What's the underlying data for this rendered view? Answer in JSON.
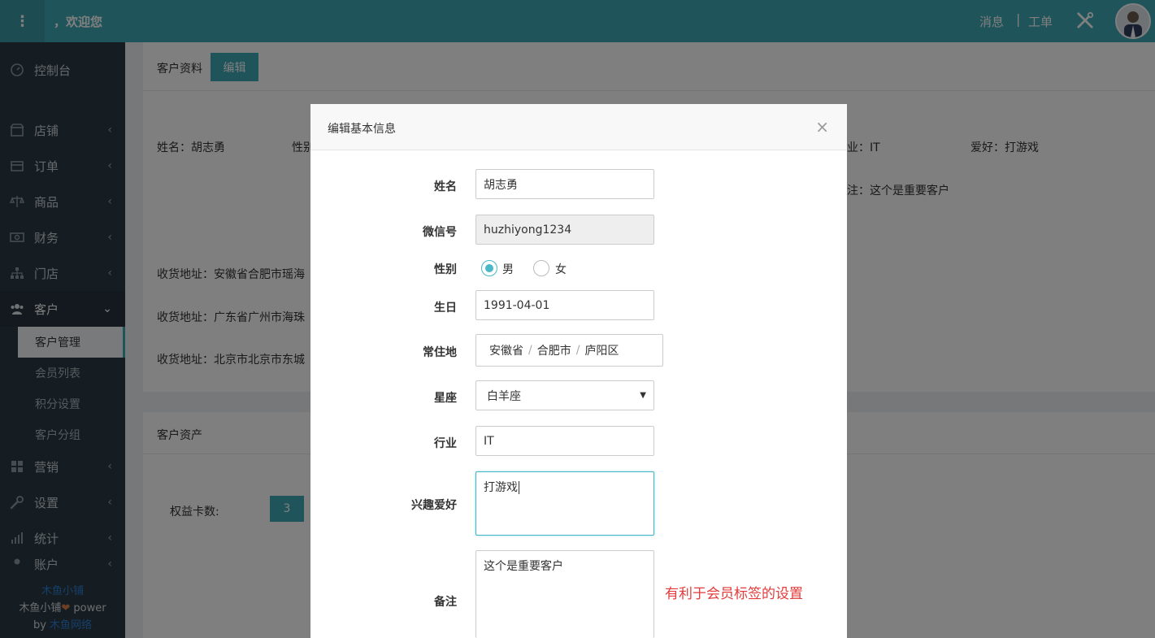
{
  "header": {
    "menu_icon": "vertical-dots-icon",
    "welcome": "，欢迎您",
    "nav_message": "消息",
    "nav_separator": "|",
    "nav_workorder": "工单",
    "tool_icon": "tools-icon"
  },
  "sidebar": {
    "items": [
      {
        "label": "控制台",
        "icon": "dashboard-icon"
      },
      {
        "label": "店铺",
        "icon": "store-icon"
      },
      {
        "label": "订单",
        "icon": "order-icon"
      },
      {
        "label": "商品",
        "icon": "scale-icon"
      },
      {
        "label": "财务",
        "icon": "money-icon"
      },
      {
        "label": "门店",
        "icon": "sitemap-icon"
      },
      {
        "label": "客户",
        "icon": "users-icon"
      },
      {
        "label": "营销",
        "icon": "marketing-icon"
      },
      {
        "label": "设置",
        "icon": "wrench-icon"
      },
      {
        "label": "统计",
        "icon": "chart-icon"
      },
      {
        "label": "账户",
        "icon": "account-icon"
      }
    ],
    "sub_items": [
      "客户管理",
      "会员列表",
      "积分设置",
      "客户分组"
    ],
    "footer": {
      "brand": "木鱼小铺",
      "power_prefix": "木鱼小铺",
      "power_suffix": " power",
      "by_prefix": "by ",
      "by_company": "木鱼网络"
    }
  },
  "profile_panel": {
    "title": "客户资料",
    "edit_label": "编辑",
    "name_line": "姓名：胡志勇",
    "gender_line": "性别",
    "industry_line": "业：IT",
    "hobby_line": "爱好：打游戏",
    "remark_line": "注：这个是重要客户",
    "addresses": [
      "收货地址：安徽省合肥市瑶海",
      "收货地址：广东省广州市海珠",
      "收货地址：北京市北京市东城"
    ]
  },
  "assets_panel": {
    "title": "客户资产",
    "card_label": "权益卡数:",
    "card_count": "3"
  },
  "modal": {
    "title": "编辑基本信息",
    "close": "×",
    "fields": {
      "name_label": "姓名",
      "name_value": "胡志勇",
      "wechat_label": "微信号",
      "wechat_value": "huzhiyong1234",
      "gender_label": "性别",
      "gender_male": "男",
      "gender_female": "女",
      "birthday_label": "生日",
      "birthday_value": "1991-04-01",
      "residence_label": "常住地",
      "residence_province": "安徽省",
      "residence_city": "合肥市",
      "residence_district": "庐阳区",
      "residence_sep": "/",
      "zodiac_label": "星座",
      "zodiac_value": "白羊座",
      "industry_label": "行业",
      "industry_value": "IT",
      "hobby_label": "兴趣爱好",
      "hobby_value": "打游戏",
      "remark_label": "备注",
      "remark_value": "这个是重要客户"
    },
    "tip": "有利于会员标签的设置"
  }
}
